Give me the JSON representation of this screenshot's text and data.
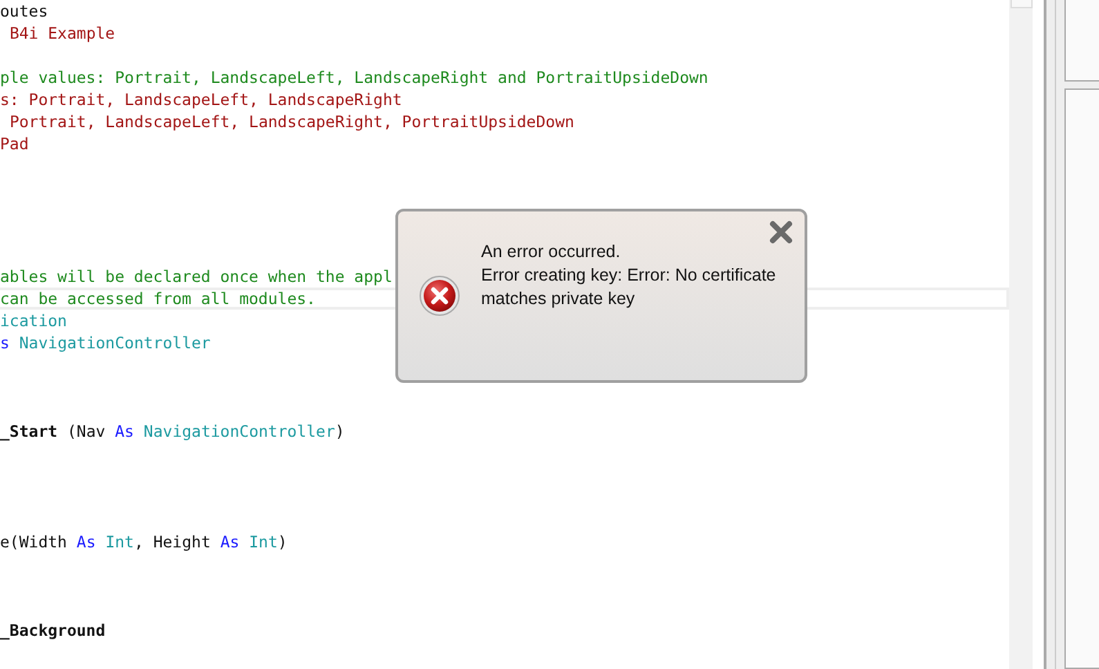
{
  "editor": {
    "lines": [
      {
        "kind": "code",
        "segments": [
          {
            "kind": "plain",
            "text": "outes"
          }
        ]
      },
      {
        "kind": "code",
        "segments": [
          {
            "kind": "string",
            "space_before": true,
            "text": "B4i Example"
          }
        ]
      },
      {
        "kind": "blank"
      },
      {
        "kind": "code",
        "segments": [
          {
            "kind": "comment",
            "text": "ple values: Portrait, LandscapeLeft, LandscapeRight and PortraitUpsideDown"
          }
        ]
      },
      {
        "kind": "code",
        "segments": [
          {
            "kind": "string",
            "text": "s: Portrait, LandscapeLeft, LandscapeRight"
          }
        ]
      },
      {
        "kind": "code",
        "segments": [
          {
            "kind": "string",
            "space_before": true,
            "text": "Portrait, LandscapeLeft, LandscapeRight, PortraitUpsideDown"
          }
        ]
      },
      {
        "kind": "code",
        "segments": [
          {
            "kind": "string",
            "text": "Pad"
          }
        ]
      },
      {
        "kind": "blank"
      },
      {
        "kind": "blank"
      },
      {
        "kind": "blank"
      },
      {
        "kind": "blank"
      },
      {
        "kind": "blank"
      },
      {
        "kind": "code",
        "segments": [
          {
            "kind": "comment",
            "text": "ables will be declared once when the appl"
          }
        ]
      },
      {
        "kind": "current",
        "segments": [
          {
            "kind": "comment",
            "text": "can be accessed from all modules."
          }
        ]
      },
      {
        "kind": "code",
        "segments": [
          {
            "kind": "type",
            "text": "ication"
          }
        ]
      },
      {
        "kind": "code",
        "segments": [
          {
            "kind": "keyword",
            "text": "s"
          },
          {
            "kind": "type",
            "space_before": true,
            "text": "NavigationController"
          }
        ]
      },
      {
        "kind": "blank"
      },
      {
        "kind": "blank"
      },
      {
        "kind": "blank"
      },
      {
        "kind": "code",
        "segments": [
          {
            "kind": "bold",
            "text": "_Start"
          },
          {
            "kind": "plain",
            "space_before": true,
            "text": "(Nav"
          },
          {
            "kind": "keyword",
            "space_before": true,
            "text": "As"
          },
          {
            "kind": "type",
            "space_before": true,
            "text": "NavigationController"
          },
          {
            "kind": "plain",
            "text": ")"
          }
        ]
      },
      {
        "kind": "blank"
      },
      {
        "kind": "blank"
      },
      {
        "kind": "blank"
      },
      {
        "kind": "blank"
      },
      {
        "kind": "code",
        "segments": [
          {
            "kind": "plain",
            "text": "e(Width"
          },
          {
            "kind": "keyword",
            "space_before": true,
            "text": "As"
          },
          {
            "kind": "type",
            "space_before": true,
            "text": "Int"
          },
          {
            "kind": "plain",
            "text": ", Height"
          },
          {
            "kind": "keyword",
            "space_before": true,
            "text": "As"
          },
          {
            "kind": "type",
            "space_before": true,
            "text": "Int"
          },
          {
            "kind": "plain",
            "text": ")"
          }
        ]
      },
      {
        "kind": "blank"
      },
      {
        "kind": "blank"
      },
      {
        "kind": "blank"
      },
      {
        "kind": "code",
        "segments": [
          {
            "kind": "bold",
            "text": "_Background"
          }
        ]
      }
    ]
  },
  "dialog": {
    "heading": "An error occurred.",
    "message": "Error creating key: Error: No certificate matches private key"
  }
}
